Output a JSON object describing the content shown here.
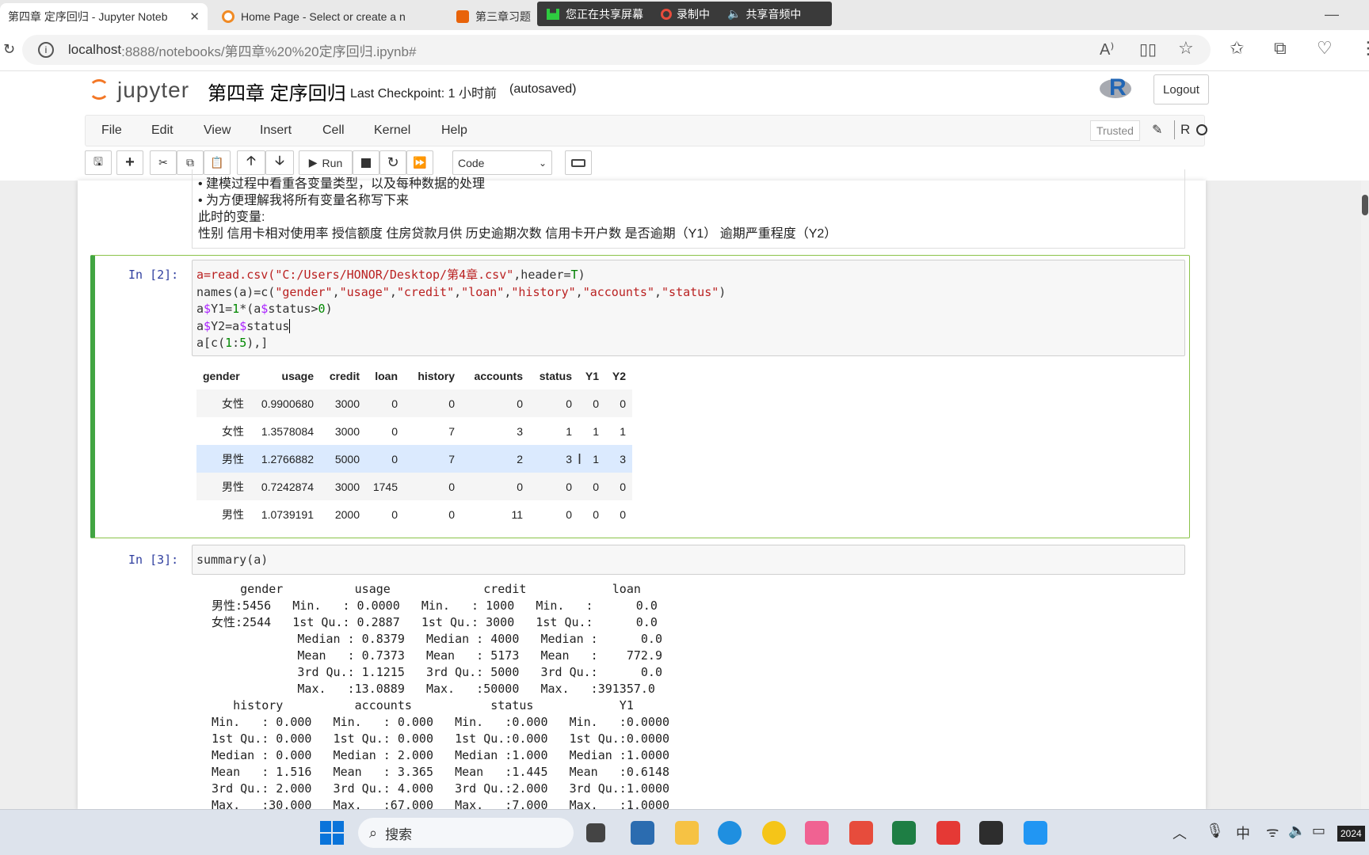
{
  "browser": {
    "tabs": [
      {
        "title": "第四章 定序回归 - Jupyter Noteb",
        "close": "✕"
      },
      {
        "title": "Home Page - Select or create a n",
        "close": ""
      },
      {
        "title": "第三章习题",
        "close": ""
      }
    ],
    "share_bar": {
      "sharing": "您正在共享屏幕",
      "recording": "录制中",
      "audio": "共享音频中"
    },
    "url_host": "localhost",
    "url_rest": ":8888/notebooks/第四章%20%20定序回归.ipynb#"
  },
  "jupyter": {
    "logo_text": "jupyter",
    "notebook_title": "第四章 定序回归",
    "checkpoint": "Last Checkpoint: 1 小时前",
    "autosaved": "(autosaved)",
    "logout": "Logout",
    "kernel_logo": "R",
    "menu": [
      "File",
      "Edit",
      "View",
      "Insert",
      "Cell",
      "Kernel",
      "Help"
    ],
    "trusted": "Trusted",
    "kernel_name": "R",
    "run_label": "Run",
    "cell_type": "Code"
  },
  "markdown_cell": {
    "lines": [
      "• 建模过程中看重各变量类型，以及每种数据的处理",
      "• 为方便理解我将所有变量名称写下来",
      "此时的变量:",
      "性别 信用卡相对使用率 授信额度 住房贷款月供 历史逾期次数 信用卡开户数 是否逾期（Y1） 逾期严重程度（Y2）"
    ]
  },
  "cell2": {
    "prompt": "In  [2]:",
    "output_table": {
      "headers": [
        "gender",
        "usage",
        "credit",
        "loan",
        "history",
        "accounts",
        "status",
        "Y1",
        "Y2"
      ],
      "rows": [
        [
          "女性",
          "0.9900680",
          "3000",
          "0",
          "0",
          "0",
          "0",
          "0",
          "0"
        ],
        [
          "女性",
          "1.3578084",
          "3000",
          "0",
          "7",
          "3",
          "1",
          "1",
          "1"
        ],
        [
          "男性",
          "1.2766882",
          "5000",
          "0",
          "7",
          "2",
          "3",
          "1",
          "3"
        ],
        [
          "男性",
          "0.7242874",
          "3000",
          "1745",
          "0",
          "0",
          "0",
          "0",
          "0"
        ],
        [
          "男性",
          "1.0739191",
          "2000",
          "0",
          "0",
          "11",
          "0",
          "0",
          "0"
        ]
      ]
    }
  },
  "cell3": {
    "prompt": "In  [3]:",
    "code": "summary(a)",
    "output": "     gender          usage             credit            loan\n 男性:5456   Min.   : 0.0000   Min.   : 1000   Min.   :      0.0\n 女性:2544   1st Qu.: 0.2887   1st Qu.: 3000   1st Qu.:      0.0\n             Median : 0.8379   Median : 4000   Median :      0.0\n             Mean   : 0.7373   Mean   : 5173   Mean   :    772.9\n             3rd Qu.: 1.1215   3rd Qu.: 5000   3rd Qu.:      0.0\n             Max.   :13.0889   Max.   :50000   Max.   :391357.0\n    history          accounts           status            Y1\n Min.   : 0.000   Min.   : 0.000   Min.   :0.000   Min.   :0.0000\n 1st Qu.: 0.000   1st Qu.: 0.000   1st Qu.:0.000   1st Qu.:0.0000\n Median : 0.000   Median : 2.000   Median :1.000   Median :1.0000\n Mean   : 1.516   Mean   : 3.365   Mean   :1.445   Mean   :0.6148\n 3rd Qu.: 2.000   3rd Qu.: 4.000   3rd Qu.:2.000   3rd Qu.:1.0000\n Max.   :30.000   Max.   :67.000   Max.   :7.000   Max.   :1.0000"
  },
  "taskbar": {
    "search_placeholder": "搜索",
    "ime": "中",
    "clock": "2024"
  }
}
